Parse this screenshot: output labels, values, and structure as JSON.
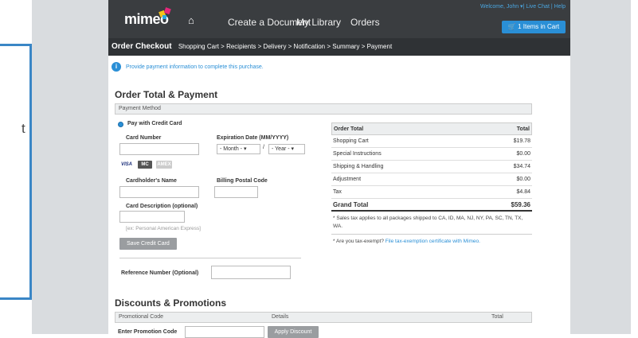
{
  "outer": {
    "partial_text": "t"
  },
  "header": {
    "logo": "mimeo",
    "nav": [
      "Create a Document",
      "My Library",
      "Orders"
    ],
    "welcome": "Welcome, John ▾| Live Chat | Help",
    "cart": "1 Items in Cart"
  },
  "breadcrumb": {
    "title": "Order Checkout",
    "steps": "Shopping Cart  >  Recipients  >  Delivery  >  Notification  >  Summary  >  Payment"
  },
  "info": "Provide payment information to complete this purchase.",
  "payment": {
    "heading": "Order Total & Payment",
    "panel": "Payment Method",
    "radio": "Pay with Credit Card",
    "card_number": "Card Number",
    "expiration": "Expiration Date (MM/YYYY)",
    "month": "- Month -",
    "year": "- Year -",
    "cardholder": "Cardholder's Name",
    "postal": "Billing Postal Code",
    "description": "Card Description (optional)",
    "desc_hint": "[ex: Personal American Express]",
    "save": "Save Credit Card",
    "reference": "Reference Number (Optional)",
    "card_brands": [
      "VISA",
      "MC",
      "AMEX"
    ]
  },
  "totals": {
    "head": [
      "Order Total",
      "Total"
    ],
    "rows": [
      [
        "Shopping Cart",
        "$19.78"
      ],
      [
        "Special Instructions",
        "$0.00"
      ],
      [
        "Shipping & Handling",
        "$34.74"
      ],
      [
        "Adjustment",
        "$0.00"
      ],
      [
        "Tax",
        "$4.84"
      ]
    ],
    "grand": [
      "Grand Total",
      "$59.36"
    ],
    "note1": "* Sales tax applies to all packages shipped to CA, ID, MA, NJ, NY, PA, SC, TN, TX, WA.",
    "note2": "* Are you tax-exempt?",
    "note2_link": "File tax-exemption certificate with Mimeo."
  },
  "discounts": {
    "heading": "Discounts & Promotions",
    "cols": [
      "Promotional Code",
      "Details",
      "Total"
    ],
    "enter": "Enter Promotion Code",
    "apply": "Apply Discount"
  }
}
